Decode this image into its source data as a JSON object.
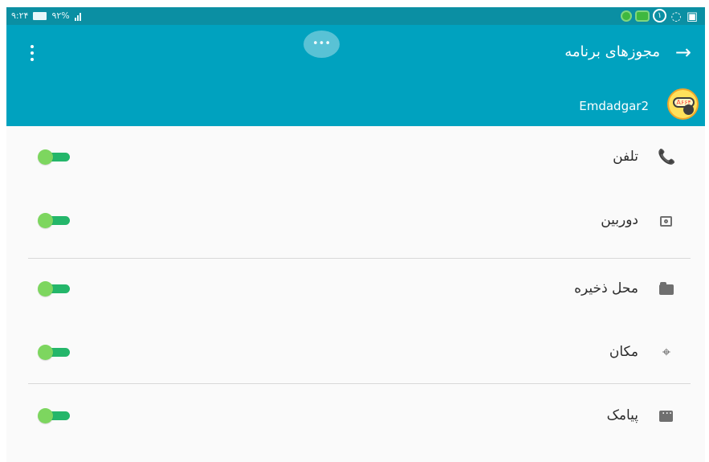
{
  "status_bar": {
    "time": "۹:۲۴",
    "battery_percent": "۹۲%",
    "notification_count": "۱"
  },
  "header": {
    "title": "مجوزهای برنامه",
    "app_name": "Emdadgar2",
    "logo_text": "A۶۶۴"
  },
  "permissions": [
    {
      "label": "تلفن",
      "icon": "phone-icon",
      "enabled": true
    },
    {
      "label": "دوربین",
      "icon": "camera-icon",
      "enabled": true
    },
    {
      "label": "محل ذخیره",
      "icon": "folder-icon",
      "enabled": true
    },
    {
      "label": "مکان",
      "icon": "location-pin-icon",
      "enabled": true
    },
    {
      "label": "پیامک",
      "icon": "message-icon",
      "enabled": true
    }
  ],
  "colors": {
    "status_bar": "#0b8fa3",
    "header": "#00a2bf",
    "toggle_track": "#24b66a",
    "toggle_thumb": "#7dd65f"
  }
}
